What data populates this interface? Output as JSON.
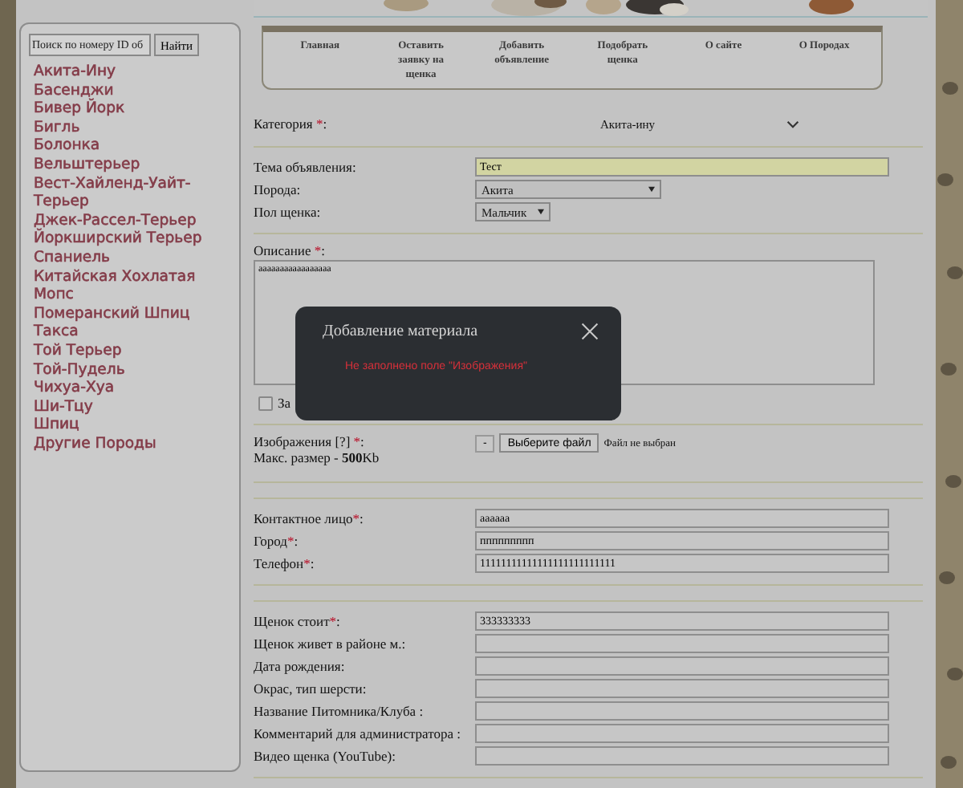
{
  "search": {
    "placeholder": "Поиск по номеру ID об",
    "button": "Найти"
  },
  "breeds": [
    "Акита-Ину",
    "Басенджи",
    "Бивер Йорк",
    "Бигль",
    "Болонка",
    "Вельштерьер",
    "Вест-Хайленд-Уайт-Терьер",
    "Джек-Рассел-Терьер",
    "Йоркширский Терьер",
    "Спаниель",
    "Китайская Хохлатая",
    "Мопс",
    "Померанский Шпиц",
    "Такса",
    "Той Терьер",
    "Той-Пудель",
    "Чихуа-Хуа",
    "Ши-Тцу",
    "Шпиц",
    "Другие Породы"
  ],
  "nav": [
    "Главная",
    "Оставить заявку на щенка",
    "Добавить объявление",
    "Подобрать щенка",
    "О сайте",
    "О Породах"
  ],
  "blocks": [
    {
      "sections": [
        {
          "fields": [
            {
              "kind": "category",
              "label": "Категория",
              "required_mark": "*",
              "label_end": ":",
              "value": "Акита-ину"
            }
          ]
        },
        {
          "fields": [
            {
              "kind": "text",
              "label": "Тема объявления:",
              "value": "Тест",
              "highlighted": true
            },
            {
              "kind": "select",
              "label": "Порода:",
              "value": "Акита"
            },
            {
              "kind": "select",
              "label": "Пол щенка:",
              "value": "Мальчик"
            }
          ]
        },
        {
          "fields": [
            {
              "kind": "textarea",
              "label": "Описание",
              "required_mark": "*",
              "label_end": ":",
              "value": "ааааааааааааааааа"
            },
            {
              "kind": "checkbox",
              "label": "За",
              "checked": false
            }
          ]
        },
        {
          "fields": [
            {
              "kind": "file",
              "label": "Изображения [?]",
              "required_mark": "*",
              "label_end": ":",
              "note": "Макс. размер - **500**Kb",
              "minus": "-",
              "button": "Выберите файл",
              "status": "Файл не выбран"
            }
          ]
        }
      ]
    },
    {
      "sections": [
        {
          "fields": [
            {
              "kind": "text",
              "label": "Контактное лицо",
              "required_mark": "*",
              "label_end": ":",
              "value": "аааааа"
            },
            {
              "kind": "text",
              "label": "Город",
              "required_mark": "*",
              "label_end": ":",
              "value": "ппппппппп"
            },
            {
              "kind": "text",
              "label": "Телефон",
              "required_mark": "*",
              "label_end": ":",
              "value": "11111111111111111111111111"
            }
          ]
        }
      ]
    },
    {
      "sections": [
        {
          "fields": [
            {
              "kind": "text",
              "label": "Щенок стоит",
              "required_mark": "*",
              "label_end": ":",
              "value": "333333333"
            },
            {
              "kind": "text",
              "label": "Щенок живет в районе м.:"
            },
            {
              "kind": "text",
              "label": "Дата рождения:"
            },
            {
              "kind": "text",
              "label": "Окрас, тип шерсти:"
            },
            {
              "kind": "text",
              "label": "Название Питомника/Клуба :"
            },
            {
              "kind": "text",
              "label": "Комментарий для администратора :"
            },
            {
              "kind": "text",
              "label": "Видео щенка (YouTube):"
            }
          ]
        }
      ]
    }
  ],
  "modal": {
    "title": "Добавление материала",
    "message": "Не заполнено поле \"Изображения\""
  }
}
